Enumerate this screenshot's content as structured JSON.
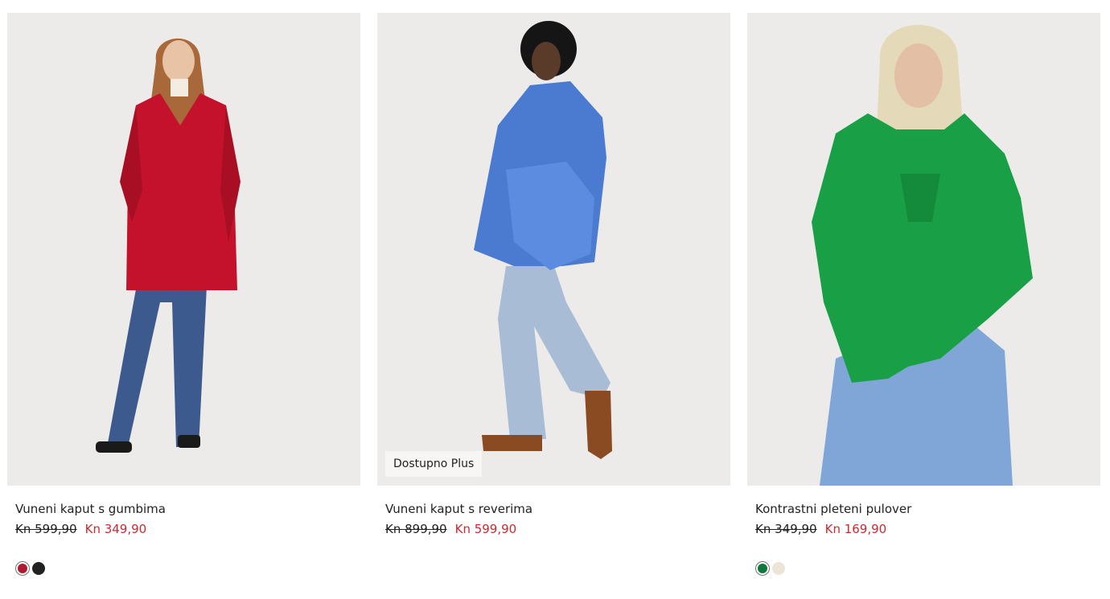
{
  "products": [
    {
      "name": "Vuneni kaput s gumbima",
      "old_price": "Kn 599,90",
      "new_price": "Kn 349,90",
      "badge": "",
      "swatches": [
        {
          "color": "#b0192f",
          "selected": true
        },
        {
          "color": "#222222",
          "selected": false
        }
      ]
    },
    {
      "name": "Vuneni kaput s reverima",
      "old_price": "Kn 899,90",
      "new_price": "Kn 599,90",
      "badge": "Dostupno Plus",
      "swatches": []
    },
    {
      "name": "Kontrastni pleteni pulover",
      "old_price": "Kn 349,90",
      "new_price": "Kn 169,90",
      "badge": "",
      "swatches": [
        {
          "color": "#0c7a3a",
          "selected": true
        },
        {
          "color": "#ece4d6",
          "selected": false
        }
      ]
    }
  ],
  "colors": {
    "background": "#ffffff",
    "image_bg": "#ecebe9",
    "sale_price": "#d0282e",
    "text": "#222222"
  }
}
